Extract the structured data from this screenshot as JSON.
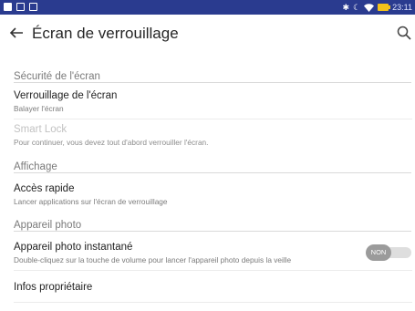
{
  "status_bar": {
    "time": "23:11",
    "icons": [
      "notification-icon",
      "message-icon",
      "image-icon",
      "bluetooth-icon",
      "moon-icon",
      "wifi-icon",
      "battery-charging-icon"
    ]
  },
  "app_bar": {
    "title": "Écran de verrouillage",
    "back_icon": "arrow-left-icon",
    "search_icon": "search-icon"
  },
  "sections": [
    {
      "header": "Sécurité de l'écran",
      "items": [
        {
          "title": "Verrouillage de l'écran",
          "summary": "Balayer l'écran",
          "enabled": true
        },
        {
          "title": "Smart Lock",
          "summary": "Pour continuer, vous devez tout d'abord verrouiller l'écran.",
          "enabled": false
        }
      ]
    },
    {
      "header": "Affichage",
      "items": [
        {
          "title": "Accès rapide",
          "summary": "Lancer applications sur l'écran de verrouillage",
          "enabled": true
        }
      ]
    },
    {
      "header": "Appareil photo",
      "items": [
        {
          "title": "Appareil photo instantané",
          "summary": "Double-cliquez sur la touche de volume pour lancer l'appareil photo depuis la veille",
          "enabled": true,
          "toggle": {
            "state": "off",
            "label": "NON"
          }
        },
        {
          "title": "Infos propriétaire",
          "enabled": true
        }
      ]
    }
  ],
  "colors": {
    "status_bar": "#2a3b8f",
    "battery": "#f3c21b",
    "toggle_thumb": "#9b9b9b",
    "toggle_track": "#dedede"
  }
}
